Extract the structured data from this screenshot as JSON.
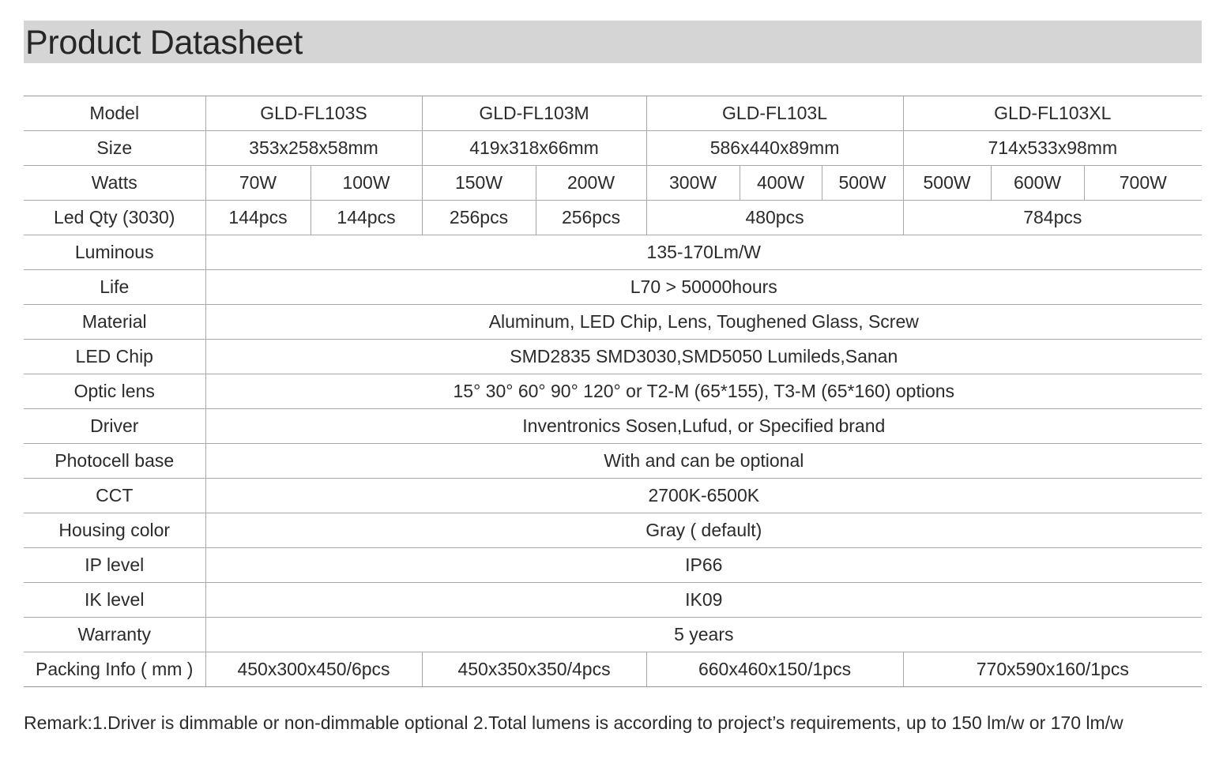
{
  "title": "Product Datasheet",
  "table": {
    "model": {
      "label": "Model",
      "values": [
        "GLD-FL103S",
        "GLD-FL103M",
        "GLD-FL103L",
        "GLD-FL103XL"
      ]
    },
    "size": {
      "label": "Size",
      "values": [
        "353x258x58mm",
        "419x318x66mm",
        "586x440x89mm",
        "714x533x98mm"
      ]
    },
    "watts": {
      "label": "Watts",
      "values": [
        "70W",
        "100W",
        "150W",
        "200W",
        "300W",
        "400W",
        "500W",
        "500W",
        "600W",
        "700W"
      ]
    },
    "led_qty": {
      "label": "Led Qty (3030)",
      "values": [
        "144pcs",
        "144pcs",
        "256pcs",
        "256pcs",
        "480pcs",
        "784pcs"
      ]
    },
    "rows": [
      {
        "label": "Luminous",
        "value": "135-170Lm/W"
      },
      {
        "label": "Life",
        "value": "L70 > 50000hours"
      },
      {
        "label": "Material",
        "value": "Aluminum, LED Chip, Lens, Toughened Glass, Screw"
      },
      {
        "label": "LED Chip",
        "value": "SMD2835 SMD3030,SMD5050 Lumileds,Sanan"
      },
      {
        "label": "Optic lens",
        "value": "15° 30° 60° 90° 120° or T2-M (65*155), T3-M (65*160) options"
      },
      {
        "label": "Driver",
        "value": "Inventronics Sosen,Lufud, or Specified brand"
      },
      {
        "label": "Photocell base",
        "value": "With and can be optional"
      },
      {
        "label": "CCT",
        "value": "2700K-6500K"
      },
      {
        "label": "Housing color",
        "value": "Gray ( default)"
      },
      {
        "label": "IP level",
        "value": "IP66"
      },
      {
        "label": "IK level",
        "value": "IK09"
      },
      {
        "label": "Warranty",
        "value": "5 years"
      }
    ],
    "packing": {
      "label": "Packing Info ( mm )",
      "values": [
        "450x300x450/6pcs",
        "450x350x350/4pcs",
        "660x460x150/1pcs",
        "770x590x160/1pcs"
      ]
    }
  },
  "remark": "Remark:1.Driver is dimmable or non-dimmable optional 2.Total lumens is according to project’s requirements,  up to 150 lm/w or 170 lm/w"
}
